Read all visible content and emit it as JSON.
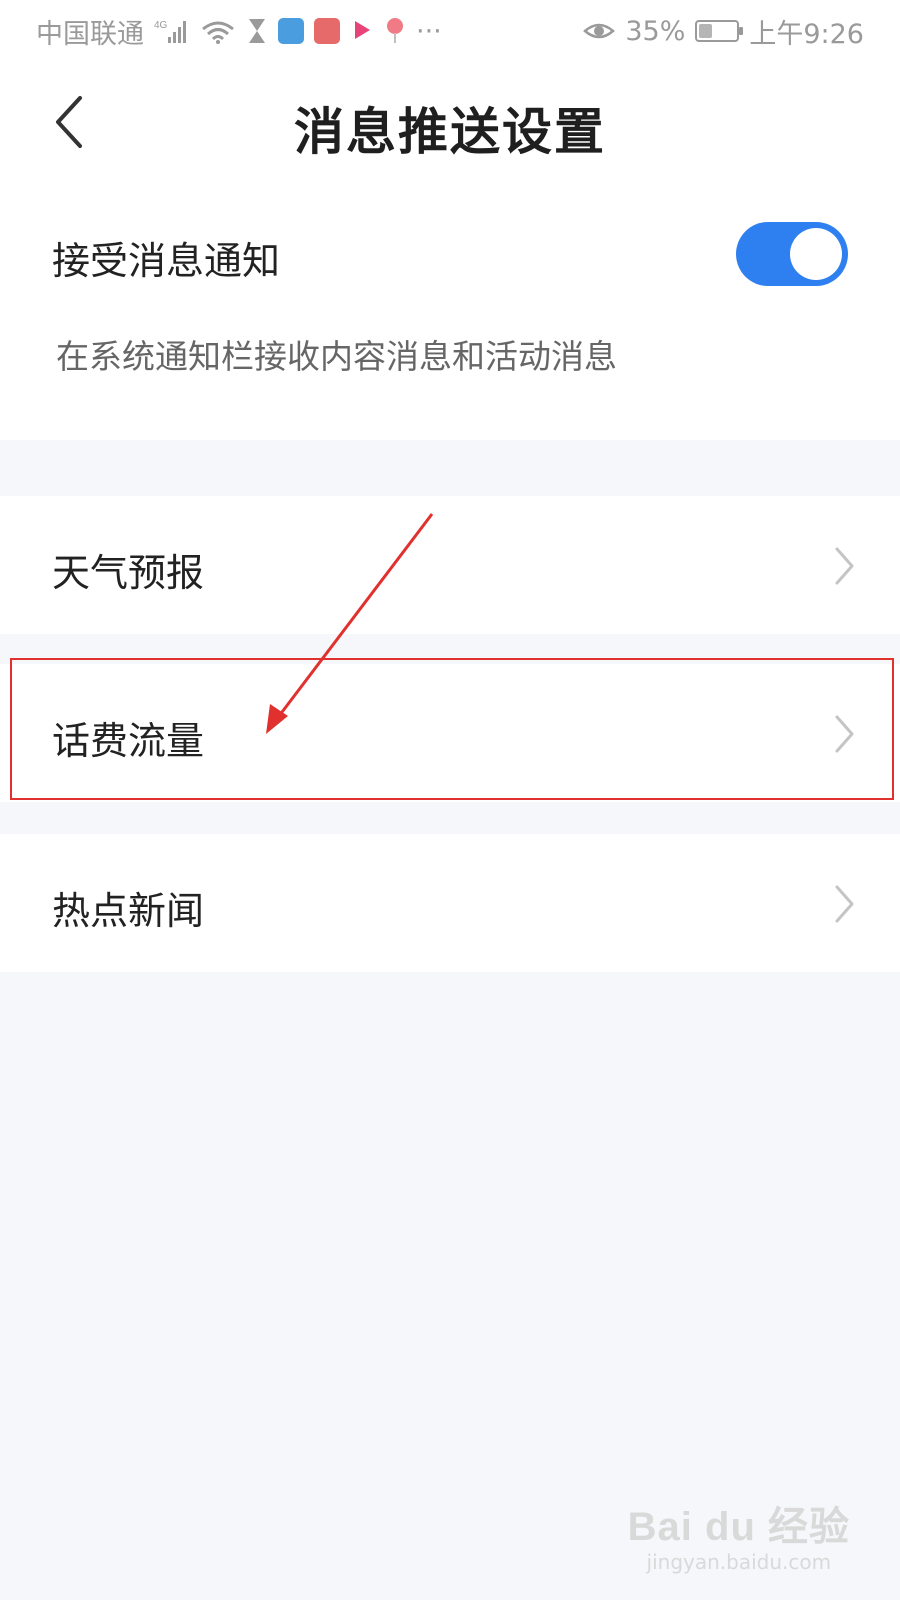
{
  "status_bar": {
    "carrier": "中国联通",
    "network": "4G",
    "more": "···",
    "battery_percent": "35%",
    "battery_level": 0.35,
    "time": "上午9:26",
    "icons": [
      "signal-icon",
      "wifi-icon",
      "hourglass-icon",
      "app-icon",
      "app-icon",
      "app-icon",
      "app-icon",
      "eye-icon",
      "battery-icon"
    ]
  },
  "nav": {
    "back_icon": "chevron-left-icon",
    "title": "消息推送设置"
  },
  "notifications": {
    "label": "接受消息通知",
    "description": "在系统通知栏接收内容消息和活动消息",
    "enabled": true,
    "toggle_color": "#2e80f0"
  },
  "list": {
    "items": [
      {
        "label": "天气预报"
      },
      {
        "label": "话费流量"
      },
      {
        "label": "热点新闻"
      }
    ],
    "chevron_icon": "chevron-right-icon"
  },
  "annotation": {
    "color": "#e0312e"
  },
  "watermark": {
    "logo": "Bai du 经验",
    "url": "jingyan.baidu.com"
  }
}
